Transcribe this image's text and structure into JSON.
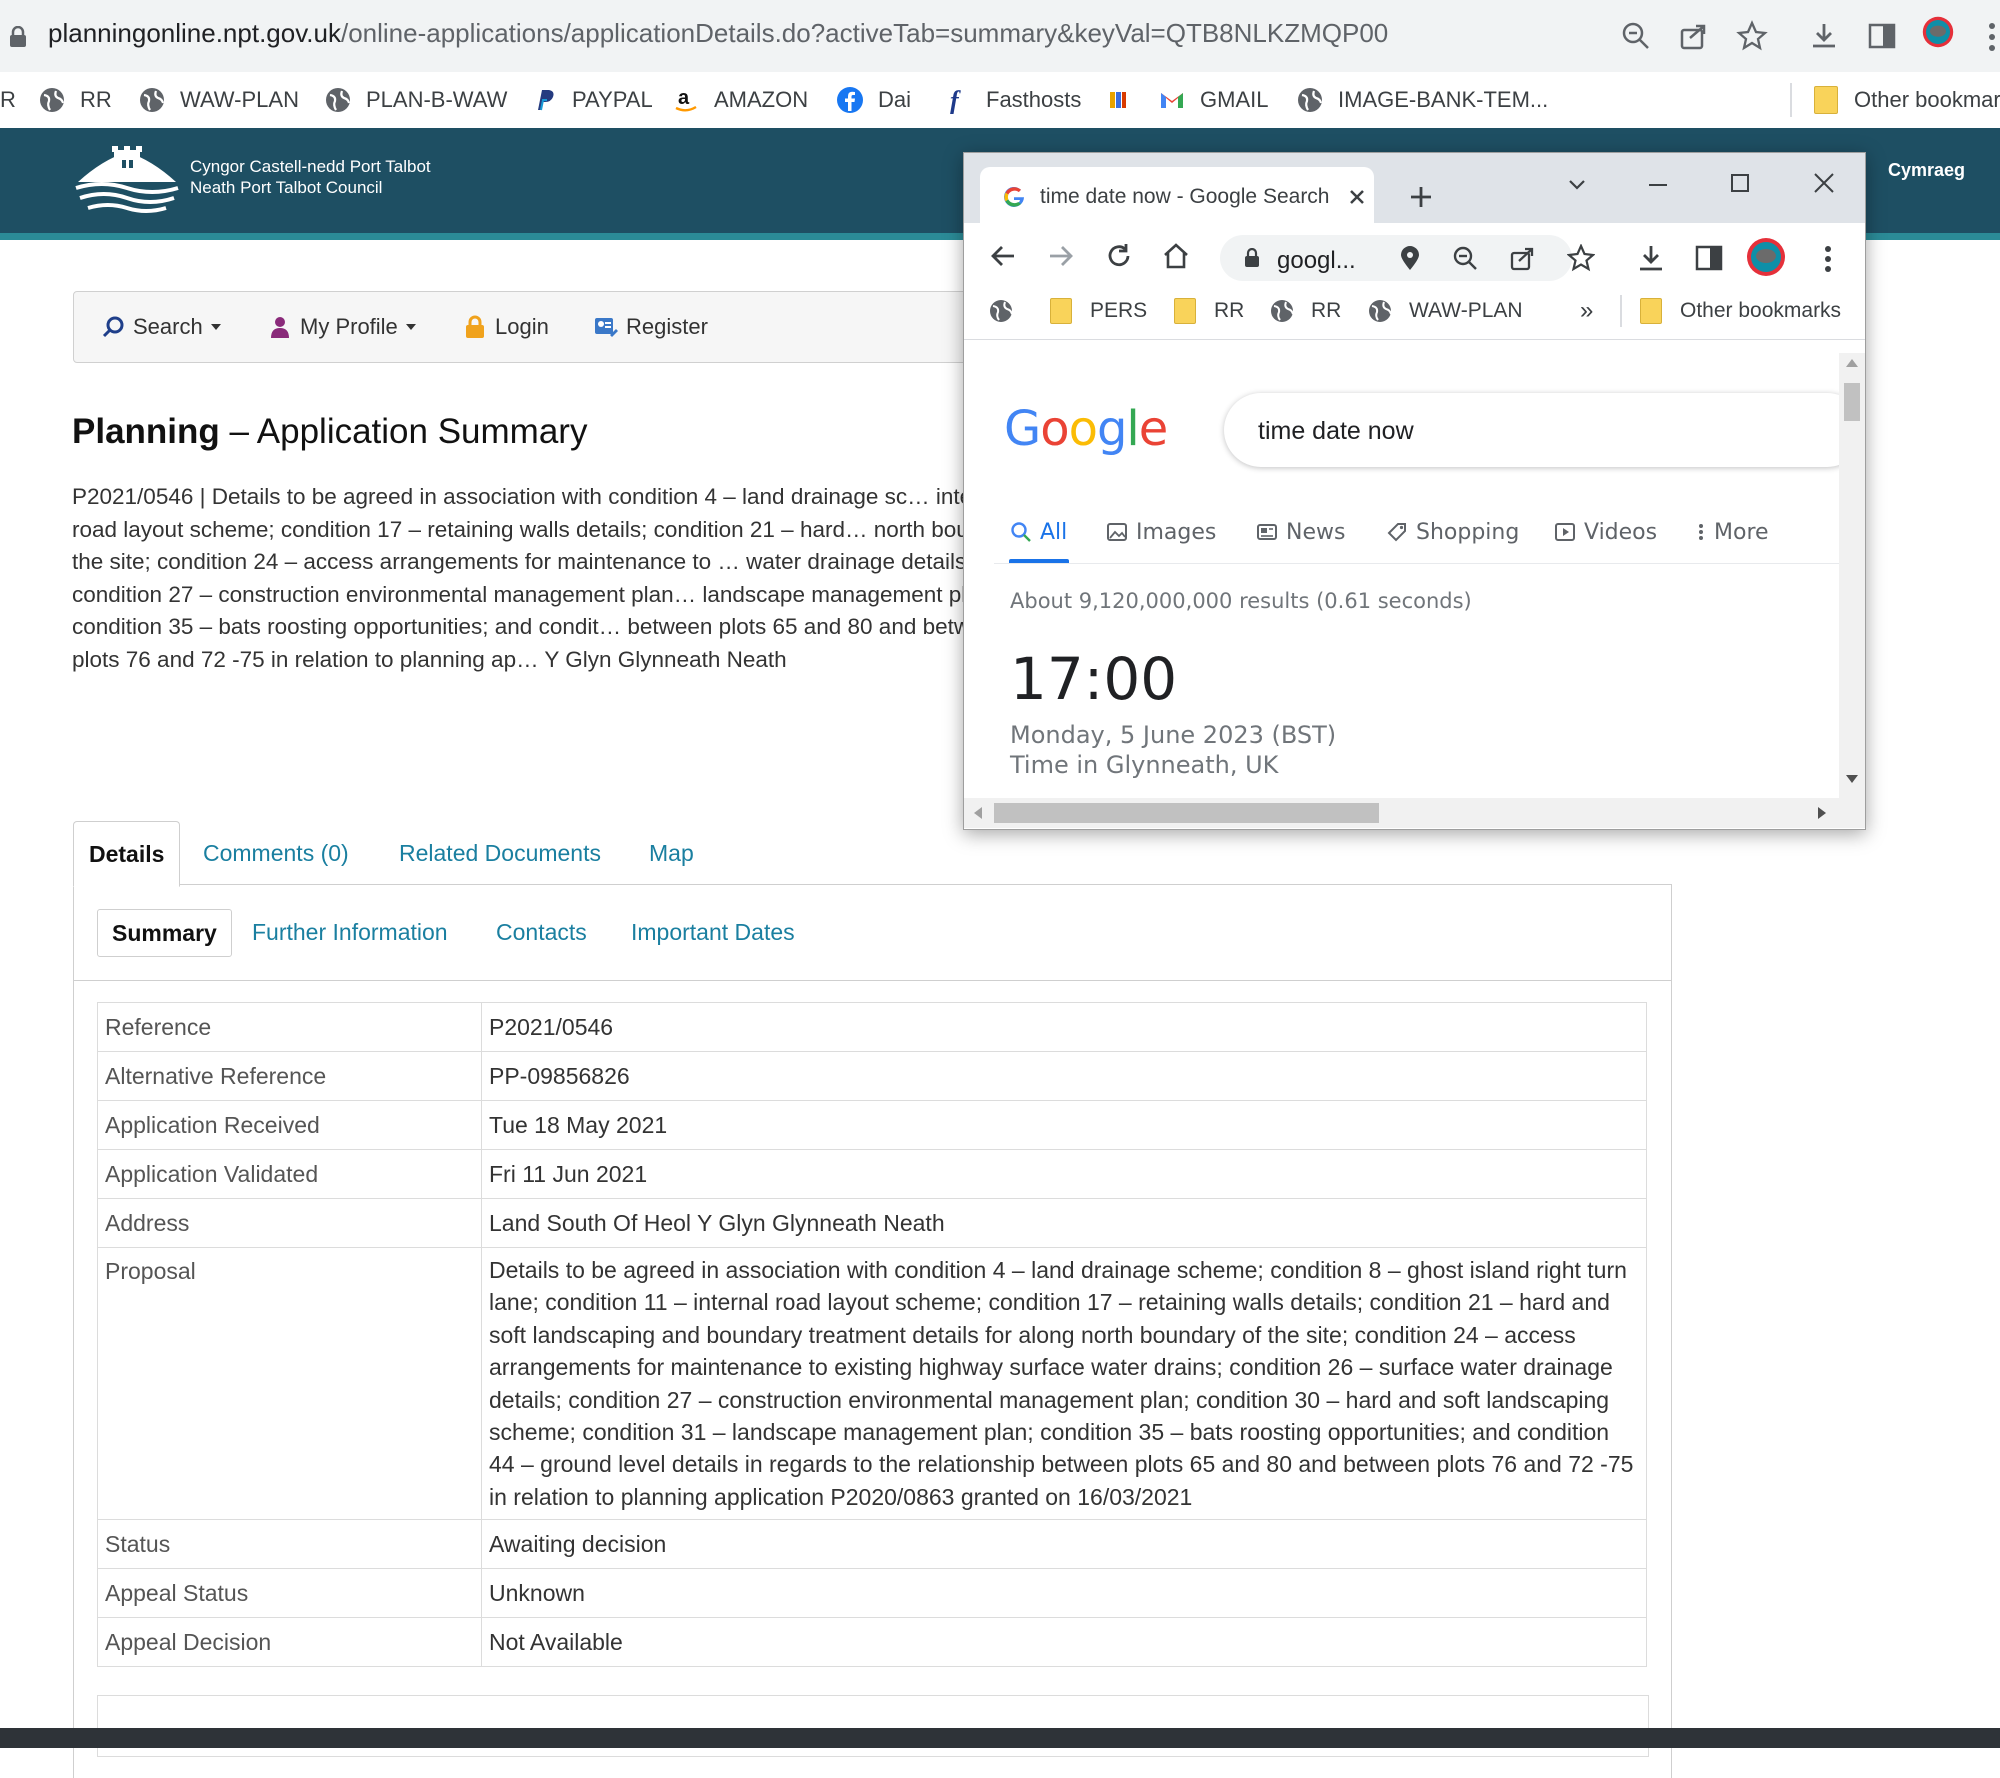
{
  "browser": {
    "url_host": "planningonline.npt.gov.uk",
    "url_path": "/online-applications/applicationDetails.do?activeTab=summary&keyVal=QTB8NLKZMQP00",
    "bookmarks": [
      {
        "label": "RR",
        "icon": "globe-icon"
      },
      {
        "label": "WAW-PLAN",
        "icon": "globe-icon"
      },
      {
        "label": "PLAN-B-WAW",
        "icon": "globe-icon"
      },
      {
        "label": "PAYPAL",
        "icon": "paypal-icon"
      },
      {
        "label": "AMAZON",
        "icon": "amazon-icon"
      },
      {
        "label": "Dai",
        "icon": "facebook-icon"
      },
      {
        "label": "Fasthosts",
        "icon": "fasthosts-icon"
      },
      {
        "label": "",
        "icon": "office-icon"
      },
      {
        "label": "GMAIL",
        "icon": "gmail-icon"
      },
      {
        "label": "IMAGE-BANK-TEM...",
        "icon": "globe-icon"
      }
    ],
    "other_bookmarks": "Other bookmarks",
    "partial_left": "R"
  },
  "council": {
    "name_welsh": "Cyngor Castell-nedd Port Talbot",
    "name_english": "Neath Port Talbot Council",
    "language_link": "Cymraeg"
  },
  "nav": {
    "search": "Search",
    "my_profile": "My Profile",
    "login": "Login",
    "register": "Register"
  },
  "page": {
    "heading_bold": "Planning",
    "heading_rest": " – Application Summary",
    "description": "P2021/0546 | Details to be agreed in association with condition 4 – land drainage sc… internal road layout scheme; condition 17 – retaining walls details; condition 21 – hard… north boundary of the site; condition 24 – access arrangements for maintenance to … water drainage details; condition 27 – construction environmental management plan… landscape management plan; condition 35 – bats roosting opportunities; and condit… between plots 65 and 80 and between plots 76 and 72 -75 in relation to planning ap… Y Glyn Glynneath Neath"
  },
  "tabs": [
    "Details",
    "Comments (0)",
    "Related Documents",
    "Map"
  ],
  "subtabs": [
    "Summary",
    "Further Information",
    "Contacts",
    "Important Dates"
  ],
  "summary": {
    "reference_label": "Reference",
    "reference": "P2021/0546",
    "alt_ref_label": "Alternative Reference",
    "alt_ref": "PP-09856826",
    "received_label": "Application Received",
    "received": "Tue 18 May 2021",
    "validated_label": "Application Validated",
    "validated": "Fri 11 Jun 2021",
    "address_label": "Address",
    "address": "Land South Of Heol Y Glyn Glynneath Neath",
    "proposal_label": "Proposal",
    "proposal": "Details to be agreed in association with condition 4 – land drainage scheme; condition 8 – ghost island right turn lane; condition 11 – internal road layout scheme; condition 17 – retaining walls details; condition 21 – hard and soft landscaping and boundary treatment details for along north boundary of the site; condition 24 – access arrangements for maintenance to existing highway surface water drains; condition 26 – surface water drainage details; condition 27 – construction environmental management plan; condition 30 – hard and soft landscaping scheme; condition 31 – landscape management plan; condition 35 – bats roosting opportunities; and condition 44 – ground level details in regards to the relationship between plots 65 and 80 and between plots 76 and 72 -75 in relation to planning application P2020/0863 granted on 16/03/2021",
    "status_label": "Status",
    "status": "Awaiting decision",
    "appeal_status_label": "Appeal Status",
    "appeal_status": "Unknown",
    "appeal_decision_label": "Appeal Decision",
    "appeal_decision": "Not Available"
  },
  "popup": {
    "tab_title": "time date now - Google Search",
    "omnibox": "googl...",
    "bookmarks": [
      {
        "label": "",
        "icon": "globe-icon"
      },
      {
        "label": "PERS",
        "icon": "folder-icon"
      },
      {
        "label": "RR",
        "icon": "folder-icon"
      },
      {
        "label": "RR",
        "icon": "globe-icon"
      },
      {
        "label": "WAW-PLAN",
        "icon": "globe-icon"
      }
    ],
    "overflow": "»",
    "other_bookmarks": "Other bookmarks",
    "google": {
      "logo": [
        "G",
        "o",
        "o",
        "g",
        "l",
        "e"
      ],
      "logo_colors": [
        "#4285f4",
        "#ea4335",
        "#fbbc05",
        "#4285f4",
        "#34a853",
        "#ea4335"
      ],
      "query": "time date now",
      "tabs": [
        "All",
        "Images",
        "News",
        "Shopping",
        "Videos",
        "More"
      ],
      "results_count": "About 9,120,000,000 results (0.61 seconds)",
      "time": "17:00",
      "date": "Monday, 5 June 2023 (BST)",
      "location": "Time in Glynneath, UK"
    }
  }
}
